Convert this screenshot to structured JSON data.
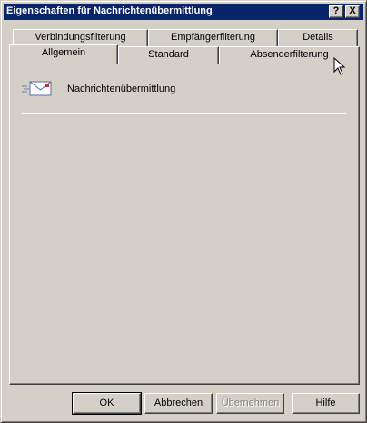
{
  "window": {
    "title": "Eigenschaften für Nachrichtenübermittlung",
    "help_button": "?",
    "close_button": "X"
  },
  "tabs": {
    "row_back": [
      "Verbindungsfilterung",
      "Empfängerfilterung",
      "Details"
    ],
    "row_front": [
      "Allgemein",
      "Standard",
      "Absenderfilterung"
    ],
    "active": "Allgemein"
  },
  "general": {
    "name": "Nachrichtenübermittlung",
    "icon": "mail-envelope-icon"
  },
  "buttons": {
    "ok": "OK",
    "cancel": "Abbrechen",
    "apply": "Übernehmen",
    "help": "Hilfe"
  }
}
